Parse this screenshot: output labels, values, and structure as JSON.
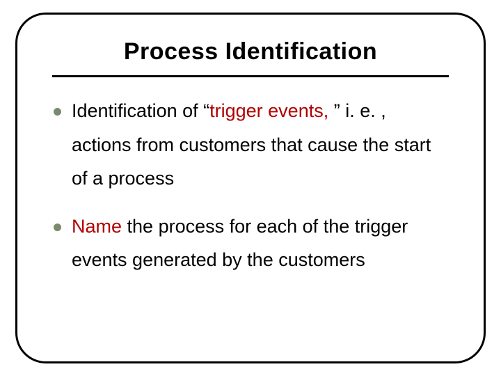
{
  "title": "Process Identification",
  "bullets": {
    "b1": {
      "pre": "Identification of “",
      "trigger": "trigger events,",
      "post": " ” i. e. , actions from customers that cause the start of a process"
    },
    "b2": {
      "name_word": "Name",
      "rest": " the process for each of the trigger events generated by the customers"
    }
  }
}
